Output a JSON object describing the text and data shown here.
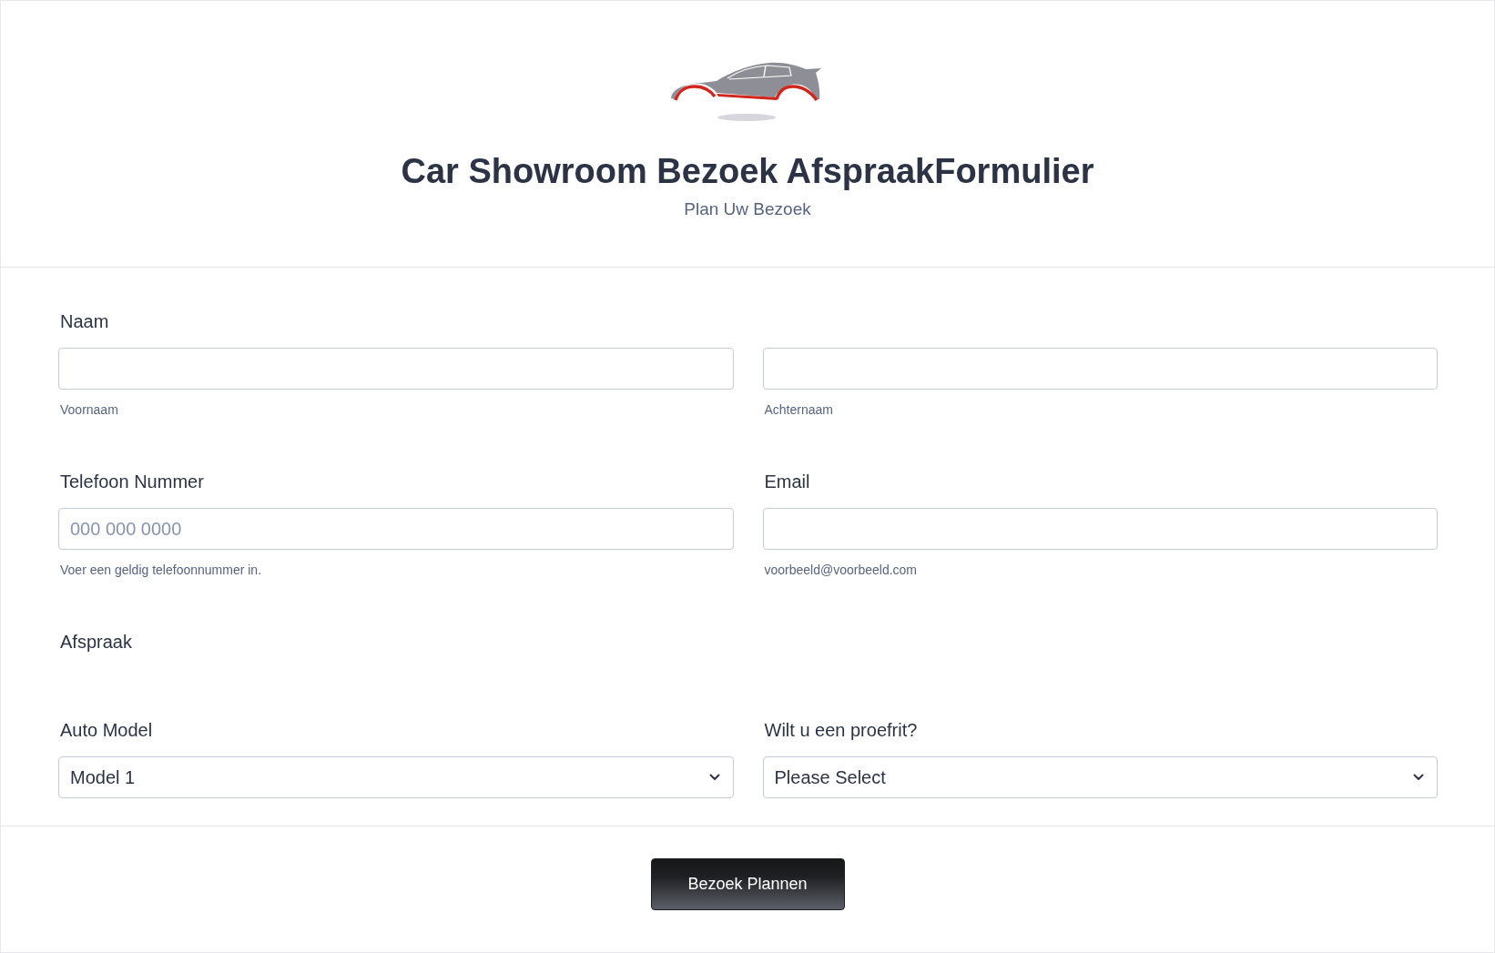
{
  "header": {
    "title": "Car Showroom Bezoek AfspraakFormulier",
    "subtitle": "Plan Uw Bezoek"
  },
  "rows": [
    {
      "kind": "group",
      "label": "Naam",
      "items": [
        {
          "kind": "text",
          "sublabel": "Voornaam"
        },
        {
          "kind": "text",
          "sublabel": "Achternaam"
        }
      ]
    },
    {
      "kind": "fields",
      "items": [
        {
          "kind": "text",
          "label": "Telefoon Nummer",
          "placeholder": "000 000 0000",
          "sublabel": "Voer een geldig telefoonnummer in."
        },
        {
          "kind": "text",
          "label": "Email",
          "sublabel": "voorbeeld@voorbeeld.com"
        }
      ]
    },
    {
      "kind": "heading",
      "label": "Afspraak"
    },
    {
      "kind": "fields",
      "items": [
        {
          "kind": "select",
          "label": "Auto Model",
          "value": "Model 1"
        },
        {
          "kind": "select",
          "label": "Wilt u een proefrit?",
          "value": "Please Select"
        }
      ]
    }
  ],
  "submit": {
    "label": "Bezoek Plannen"
  }
}
